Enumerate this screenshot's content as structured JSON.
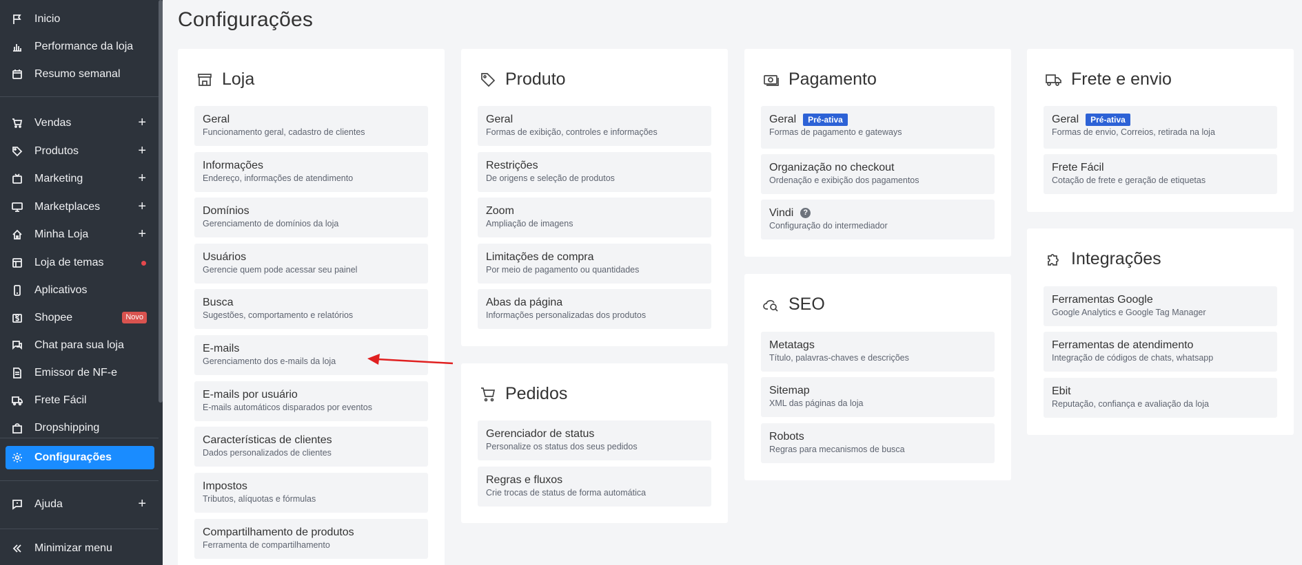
{
  "page_title": "Configurações",
  "sidebar": {
    "items": [
      {
        "label": "Inicio",
        "icon": "flag-icon"
      },
      {
        "label": "Performance da loja",
        "icon": "bar-chart-icon"
      },
      {
        "label": "Resumo semanal",
        "icon": "calendar-icon"
      },
      {
        "label": "Vendas",
        "icon": "cart-icon",
        "expand": "+"
      },
      {
        "label": "Produtos",
        "icon": "tag-icon",
        "expand": "+"
      },
      {
        "label": "Marketing",
        "icon": "tv-icon",
        "expand": "+"
      },
      {
        "label": "Marketplaces",
        "icon": "monitor-icon",
        "expand": "+"
      },
      {
        "label": "Minha Loja",
        "icon": "home-icon",
        "expand": "+"
      },
      {
        "label": "Loja de temas",
        "icon": "layout-icon"
      },
      {
        "label": "Aplicativos",
        "icon": "phone-icon"
      },
      {
        "label": "Shopee",
        "icon": "shopee-icon",
        "badge": "Novo"
      },
      {
        "label": "Chat para sua loja",
        "icon": "chat-icon"
      },
      {
        "label": "Emissor de NF-e",
        "icon": "document-icon"
      },
      {
        "label": "Frete Fácil",
        "icon": "truck-icon"
      },
      {
        "label": "Dropshipping",
        "icon": "bag-icon"
      },
      {
        "label": "Configurações",
        "icon": "gear-icon"
      },
      {
        "label": "Ajuda",
        "icon": "help-chat-icon",
        "expand": "+"
      },
      {
        "label": "Minimizar menu",
        "icon": "double-chevron-left-icon"
      }
    ]
  },
  "loja": {
    "title": "Loja",
    "items": [
      {
        "title": "Geral",
        "sub": "Funcionamento geral, cadastro de clientes"
      },
      {
        "title": "Informações",
        "sub": "Endereço, informações de atendimento"
      },
      {
        "title": "Domínios",
        "sub": "Gerenciamento de domínios da loja"
      },
      {
        "title": "Usuários",
        "sub": "Gerencie quem pode acessar seu painel"
      },
      {
        "title": "Busca",
        "sub": "Sugestões, comportamento e relatórios"
      },
      {
        "title": "E-mails",
        "sub": "Gerenciamento dos e-mails da loja"
      },
      {
        "title": "E-mails por usuário",
        "sub": "E-mails automáticos disparados por eventos"
      },
      {
        "title": "Características de clientes",
        "sub": "Dados personalizados de clientes"
      },
      {
        "title": "Impostos",
        "sub": "Tributos, alíquotas e fórmulas"
      },
      {
        "title": "Compartilhamento de produtos",
        "sub": "Ferramenta de compartilhamento"
      }
    ]
  },
  "produto": {
    "title": "Produto",
    "items": [
      {
        "title": "Geral",
        "sub": "Formas de exibição, controles e informações"
      },
      {
        "title": "Restrições",
        "sub": "De origens e seleção de produtos"
      },
      {
        "title": "Zoom",
        "sub": "Ampliação de imagens"
      },
      {
        "title": "Limitações de compra",
        "sub": "Por meio de pagamento ou quantidades"
      },
      {
        "title": "Abas da página",
        "sub": "Informações personalizadas dos produtos"
      }
    ]
  },
  "pedidos": {
    "title": "Pedidos",
    "items": [
      {
        "title": "Gerenciador de status",
        "sub": "Personalize os status dos seus pedidos"
      },
      {
        "title": "Regras e fluxos",
        "sub": "Crie trocas de status de forma automática"
      }
    ]
  },
  "pagamento": {
    "title": "Pagamento",
    "items": [
      {
        "title": "Geral",
        "badge": "Pré-ativa",
        "sub": "Formas de pagamento e gateways"
      },
      {
        "title": "Organização no checkout",
        "sub": "Ordenação e exibição dos pagamentos"
      },
      {
        "title": "Vindi",
        "help": "?",
        "sub": "Configuração do intermediador"
      }
    ]
  },
  "seo": {
    "title": "SEO",
    "items": [
      {
        "title": "Metatags",
        "sub": "Título, palavras-chaves e descrições"
      },
      {
        "title": "Sitemap",
        "sub": "XML das páginas da loja"
      },
      {
        "title": "Robots",
        "sub": "Regras para mecanismos de busca"
      }
    ]
  },
  "frete": {
    "title": "Frete e envio",
    "items": [
      {
        "title": "Geral",
        "badge": "Pré-ativa",
        "sub": "Formas de envio, Correios, retirada na loja"
      },
      {
        "title": "Frete Fácil",
        "sub": "Cotação de frete e geração de etiquetas"
      }
    ]
  },
  "integracoes": {
    "title": "Integrações",
    "items": [
      {
        "title": "Ferramentas Google",
        "sub": "Google Analytics e Google Tag Manager"
      },
      {
        "title": "Ferramentas de atendimento",
        "sub": "Integração de códigos de chats, whatsapp"
      },
      {
        "title": "Ebit",
        "sub": "Reputação, confiança e avaliação da loja"
      }
    ]
  },
  "colors": {
    "sidebar_bg": "#2d333b",
    "active": "#1a8cff",
    "badge_pre": "#2d62d6",
    "annotation_arrow": "#e02020"
  }
}
